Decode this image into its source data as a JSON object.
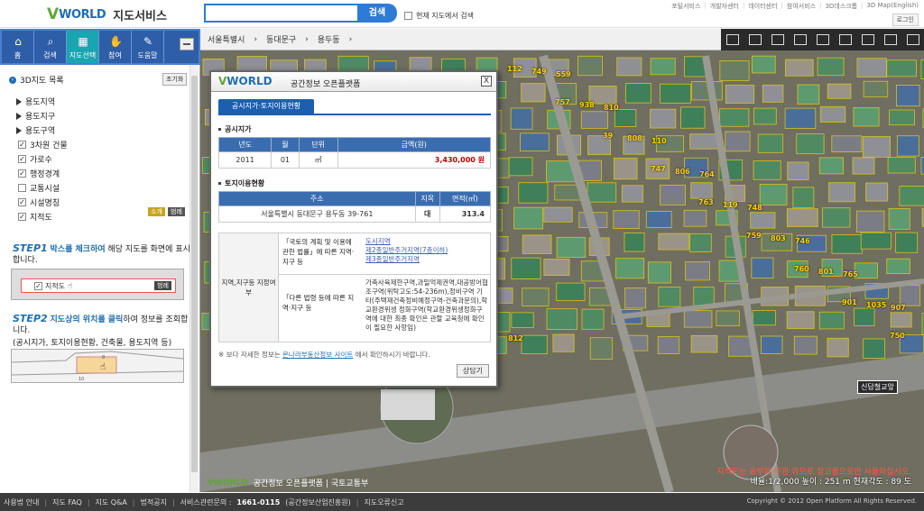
{
  "header": {
    "logo_v": "V",
    "logo_world": "WORLD",
    "logo_title": "지도서비스",
    "search_placeholder": "",
    "search_button": "검색",
    "current_map_search": "현재 지도에서 검색",
    "links": [
      "포털서비스",
      "개발자센터",
      "데이터센터",
      "참여서비스",
      "3D데스크톱",
      "3D Map(English)"
    ],
    "login": "로그인"
  },
  "nav": {
    "items": [
      {
        "label": "홈",
        "icon": "home-icon",
        "glyph": "⌂"
      },
      {
        "label": "검색",
        "icon": "search-icon",
        "glyph": "⌕"
      },
      {
        "label": "지도선택",
        "icon": "map-select-icon",
        "glyph": "▦"
      },
      {
        "label": "참여",
        "icon": "participate-icon",
        "glyph": "✋"
      },
      {
        "label": "도움말",
        "icon": "help-icon",
        "glyph": "✎"
      }
    ],
    "active": 2
  },
  "layers": {
    "title": "3D지도 목록",
    "reset": "초기화",
    "groups": [
      "용도지역",
      "용도지구",
      "용도구역"
    ],
    "items": [
      {
        "label": "3차원 건물",
        "checked": true
      },
      {
        "label": "가로수",
        "checked": true
      },
      {
        "label": "행정경계",
        "checked": true
      },
      {
        "label": "교통시설",
        "checked": false
      },
      {
        "label": "시설명칭",
        "checked": true
      },
      {
        "label": "지적도",
        "checked": true
      }
    ],
    "tag_intro": "소개",
    "tag_legend": "범례"
  },
  "help": {
    "step1_num": "STEP1",
    "step1_hl": "박스를 체크하여",
    "step1_rest": "해당 지도를 화면에 표시합니다.",
    "demo_label": "지적도",
    "demo_btn": "범례",
    "step2_num": "STEP2",
    "step2_hl": "지도상의 위치를 클릭",
    "step2_rest": "하여 정보를 조회합니다.",
    "step2_note": "(공시지가, 토지이용현황, 건축물, 용도지역 등)"
  },
  "map": {
    "breadcrumb": [
      "서울특별시",
      "동대문구",
      "용두동"
    ],
    "scale": "배율:1/2,000  높이 : 251 m  현재각도 : 89 도",
    "legal": "지적도는 공부와 무관 하므로 참고용으로만 사용하십시오.",
    "station": "신답철교앞",
    "footmark": "공간정보 오픈플랫폼 | 국토교통부",
    "parcels": [
      "112",
      "757",
      "39",
      "747",
      "763",
      "759",
      "760",
      "901",
      "750",
      "749",
      "938",
      "808",
      "806",
      "119",
      "803",
      "801",
      "1035",
      "812",
      "559",
      "810",
      "110",
      "764",
      "748",
      "746",
      "765",
      "907"
    ]
  },
  "popup": {
    "logo": "VWORLD",
    "title": "공간정보 오픈플랫폼",
    "close": "X",
    "tab": "공시지가·토지이용현황",
    "sec1": "공시지가",
    "price_headers": [
      "년도",
      "월",
      "단위",
      "금액(원)"
    ],
    "price_row": {
      "year": "2011",
      "month": "01",
      "unit": "㎡",
      "amount": "3,430,000 원"
    },
    "sec2": "토지이용현황",
    "use_headers": [
      "주소",
      "지목",
      "면적(㎡)"
    ],
    "use_row": {
      "address": "서울특별시 동대문구 용두동 39-761",
      "jimok": "대",
      "area": "313.4"
    },
    "zone_label": "지역,지구등 지정여부",
    "q1": "「국토의 계획 및 이용에 관한 법률」에 따른 지역·지구 등",
    "a1": [
      "도시지역",
      "제2종일반주거지역(7층이하)",
      "제3종일반주거지역"
    ],
    "q2": "「다른 법령 등에 따른 지역·지구 등",
    "a2": "가축사육제한구역,과밀억제권역,대공방어협조구역(위탁고도:54-236m),정비구역 기타(주택재건축정비예정구역-건축과문의),학교환경위생 정화구역(학교환경위생정화구역에 대한 최종 확인은 관할 교육청에 확인이 필요한 사항임)",
    "note_pre": "※ 보다 자세한 정보는",
    "note_link": "온나라부동산정보 사이트",
    "note_post": "에서 확인하시기 바랍니다.",
    "detail": "상담기"
  },
  "footer": {
    "items": [
      "사용법 안내",
      "지도 FAQ",
      "지도 Q&A",
      "법적공지",
      "서비스관련문의 :"
    ],
    "phone": "1661-0115",
    "phone_note": "(공간정보산업진흥원)",
    "last": "지도오류신고",
    "copyright": "Copyright © 2012 Open Platform All Rights Reserved."
  }
}
